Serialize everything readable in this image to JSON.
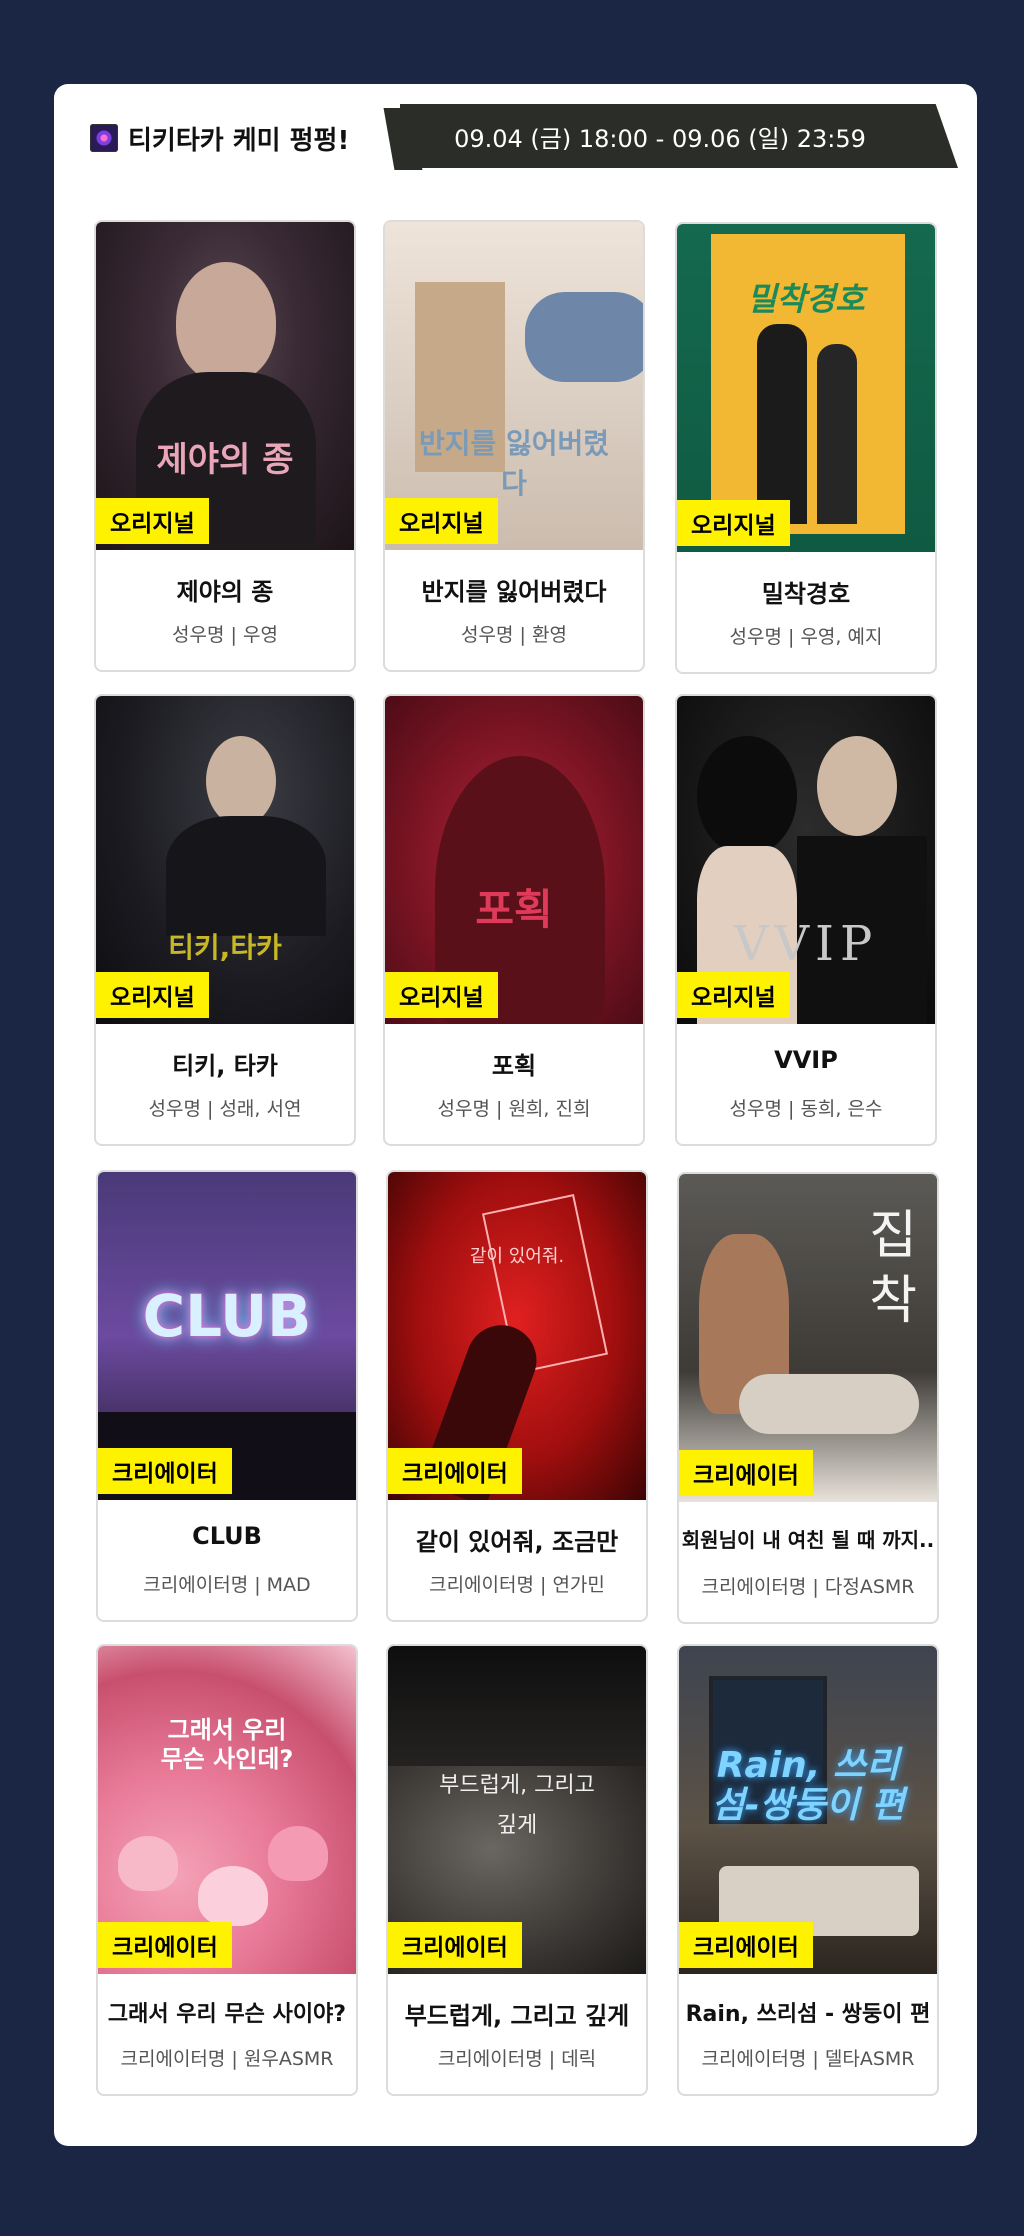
{
  "header": {
    "title": "티키타카 케미 펑펑!",
    "period": "09.04 (금) 18:00 - 09.06 (일) 23:59"
  },
  "cards": [
    {
      "badge": "오리지널",
      "title": "제야의 종",
      "sub": "성우명 | 우영",
      "poster_text": "제야의 종"
    },
    {
      "badge": "오리지널",
      "title": "반지를 잃어버렸다",
      "sub": "성우명 | 환영",
      "poster_text": "반지를 잃어버렸다"
    },
    {
      "badge": "오리지널",
      "title": "밀착경호",
      "sub": "성우명 | 우영, 예지",
      "poster_text": "밀착경호"
    },
    {
      "badge": "오리지널",
      "title": "티키, 타카",
      "sub": "성우명 | 성래, 서연",
      "poster_text": "티키,타카"
    },
    {
      "badge": "오리지널",
      "title": "포획",
      "sub": "성우명 | 원희, 진희",
      "poster_text": "포획"
    },
    {
      "badge": "오리지널",
      "title": "VVIP",
      "sub": "성우명 | 동희, 은수",
      "poster_text": "VVIP"
    },
    {
      "badge": "크리에이터",
      "title": "CLUB",
      "sub": "크리에이터명 | MAD",
      "poster_text": "CLUB"
    },
    {
      "badge": "크리에이터",
      "title": "같이 있어줘, 조금만",
      "sub": "크리에이터명 | 연가민",
      "poster_text": "같이 있어줘."
    },
    {
      "badge": "크리에이터",
      "title": "회원님이 내 여친 될 때 까지..",
      "sub": "크리에이터명 | 다정ASMR",
      "poster_text": "집착"
    },
    {
      "badge": "크리에이터",
      "title": "그래서 우리 무슨 사이야?",
      "sub": "크리에이터명 | 원우ASMR",
      "poster_text": "그래서 우리 무슨 사인데?"
    },
    {
      "badge": "크리에이터",
      "title": "부드럽게, 그리고 깊게",
      "sub": "크리에이터명 | 데릭",
      "poster_text": "부드럽게, 그리고 깊게"
    },
    {
      "badge": "크리에이터",
      "title": "Rain, 쓰리섬 - 쌍둥이 편",
      "sub": "크리에이터명 | 델타ASMR",
      "poster_text": "Rain, 쓰리섬-쌍둥이 편"
    }
  ]
}
